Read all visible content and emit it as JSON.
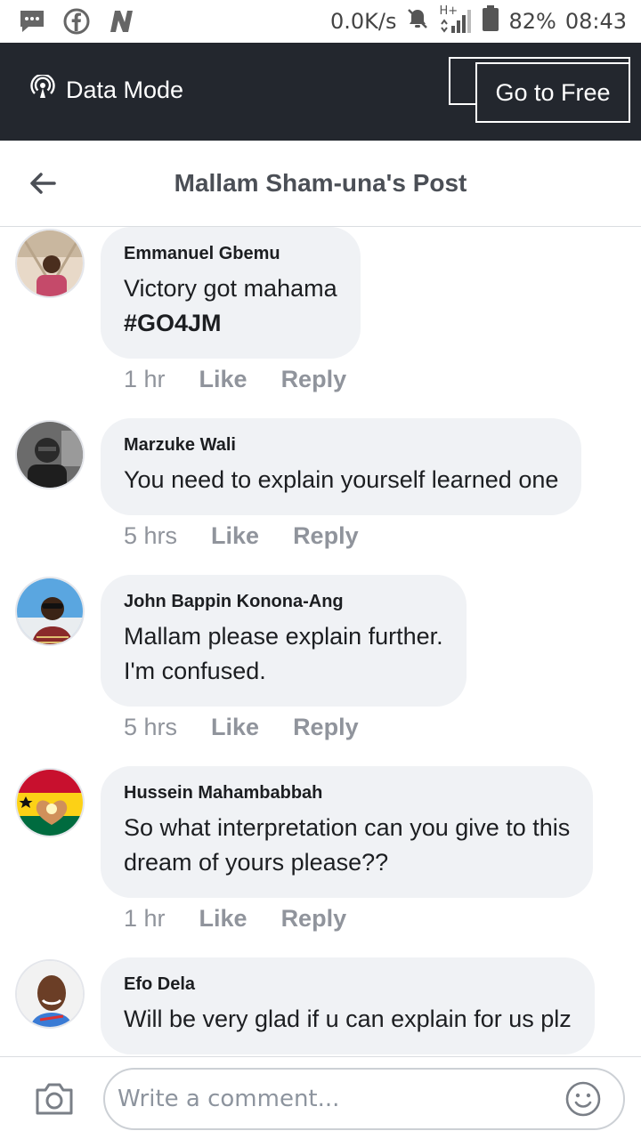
{
  "status_bar": {
    "network_speed": "0.0K/s",
    "network_type": "H+",
    "battery": "82%",
    "time": "08:43",
    "left_icons": [
      "messages-icon",
      "facebook-icon",
      "n-app-icon"
    ]
  },
  "data_bar": {
    "label": "Data Mode",
    "button": "Go to Free"
  },
  "header": {
    "title": "Mallam Sham-una's Post"
  },
  "comments": [
    {
      "author": "Emmanuel Gbemu",
      "text": "Victory got mahama",
      "hashtag": "#GO4JM",
      "time": "1 hr",
      "like": "Like",
      "reply": "Reply"
    },
    {
      "author": "Marzuke Wali",
      "text": "You need to explain yourself learned one",
      "time": "5 hrs",
      "like": "Like",
      "reply": "Reply"
    },
    {
      "author": "John Bappin Konona-Ang",
      "text1": "Mallam please explain further.",
      "text2": "I'm confused.",
      "time": "5 hrs",
      "like": "Like",
      "reply": "Reply"
    },
    {
      "author": "Hussein Mahambabbah",
      "text1": "So what interpretation can you give to this",
      "text2": "dream of yours please??",
      "time": "1 hr",
      "like": "Like",
      "reply": "Reply"
    },
    {
      "author": "Efo Dela",
      "text": "Will be very glad if u can explain for us plz"
    }
  ],
  "composer": {
    "placeholder": "Write a comment..."
  },
  "colors": {
    "data_bar_bg": "#23272e",
    "bubble_bg": "#f0f2f5",
    "meta_text": "#90949c"
  }
}
